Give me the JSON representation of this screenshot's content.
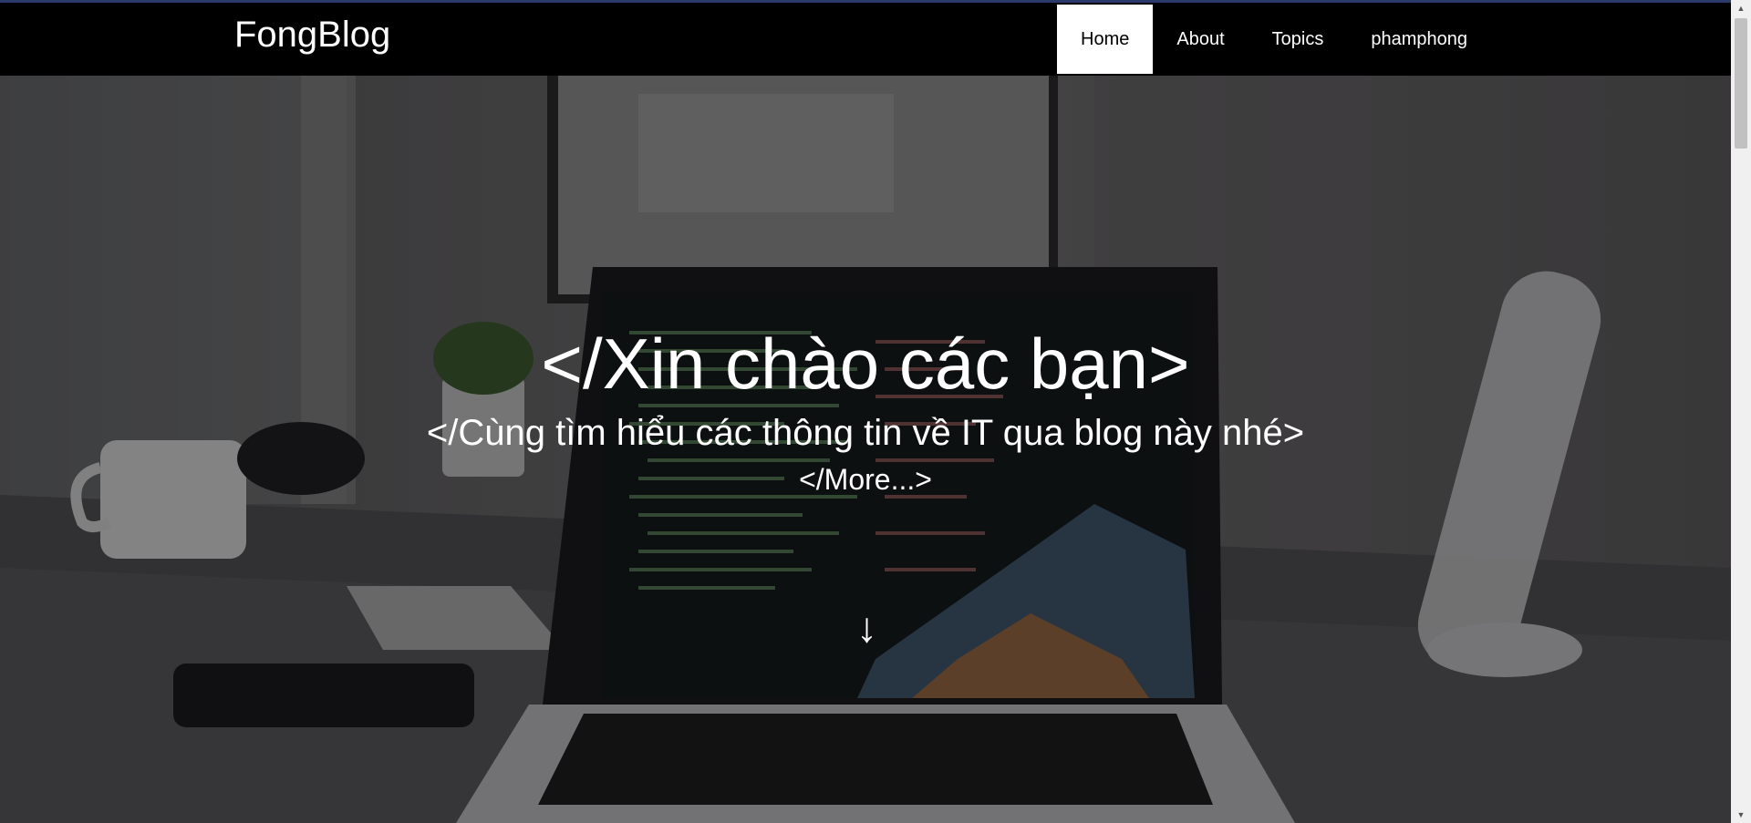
{
  "navbar": {
    "brand": "FongBlog",
    "items": [
      {
        "label": "Home",
        "active": true
      },
      {
        "label": "About",
        "active": false
      },
      {
        "label": "Topics",
        "active": false
      },
      {
        "label": "phamphong",
        "active": false
      }
    ]
  },
  "hero": {
    "title": "</Xin chào các bạn>",
    "subtitle": "</Cùng tìm hiểu các thông tin về IT qua blog này nhé>",
    "more_link": "</More...>",
    "scroll_arrow": "↓"
  },
  "colors": {
    "navbar_bg": "#000000",
    "active_item_bg": "#ffffff",
    "text": "#ffffff",
    "top_strip": "#2b3a6b"
  },
  "icons": {
    "scroll_down": "arrow-down-icon",
    "scroll_up": "scrollbar-up-icon",
    "scroll_down_bar": "scrollbar-down-icon"
  }
}
